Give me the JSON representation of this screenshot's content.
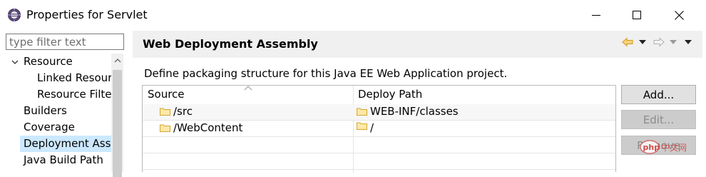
{
  "window": {
    "title": "Properties for Servlet",
    "icon": "eclipse-gear-icon",
    "controls": [
      "minimize-icon",
      "maximize-icon",
      "close-icon"
    ]
  },
  "filter": {
    "placeholder": "type filter text",
    "value": ""
  },
  "tree": {
    "items": [
      {
        "label": "Resource",
        "expanded": true,
        "level": 0
      },
      {
        "label": "Linked Resour",
        "level": 1
      },
      {
        "label": "Resource Filte",
        "level": 1
      },
      {
        "label": "Builders",
        "level": 0
      },
      {
        "label": "Coverage",
        "level": 0
      },
      {
        "label": "Deployment Ass",
        "level": 0,
        "selected": true
      },
      {
        "label": "Java Build Path",
        "level": 0
      }
    ]
  },
  "page": {
    "title": "Web Deployment Assembly",
    "description": "Define packaging structure for this Java EE Web Application project.",
    "nav_icons": [
      "back-arrow-icon",
      "dropdown-icon",
      "forward-arrow-icon",
      "dropdown-icon",
      "view-menu-icon"
    ]
  },
  "table": {
    "columns": [
      "Source",
      "Deploy Path"
    ],
    "rows": [
      {
        "source": "/src",
        "deploy": "WEB-INF/classes"
      },
      {
        "source": "/WebContent",
        "deploy": "/"
      }
    ]
  },
  "buttons": {
    "add": "Add...",
    "edit": "Edit...",
    "remove": "Remove"
  },
  "colors": {
    "selection": "#cce8ff",
    "header_band": "#f0f0f0",
    "folder": "#f5c342",
    "nav_arrow": "#e8b23a"
  },
  "watermark": "php"
}
